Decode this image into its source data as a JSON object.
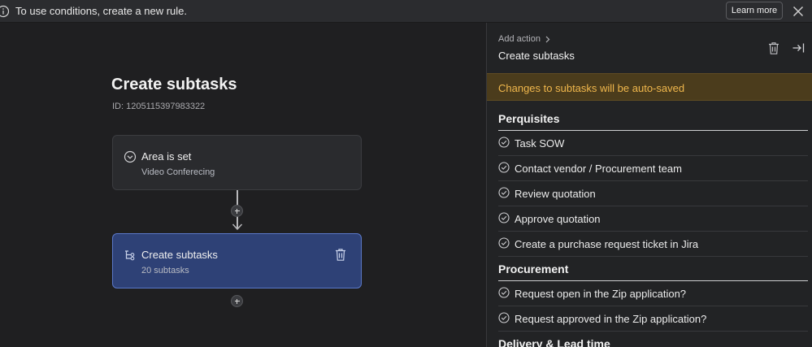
{
  "banner": {
    "message": "To use conditions, create a new rule.",
    "learn_more": "Learn more"
  },
  "rule": {
    "title": "Create subtasks",
    "id": "ID: 1205115397983322"
  },
  "condition_card": {
    "title": "Area is set",
    "subtitle": "Video Conferecing"
  },
  "action_card": {
    "title": "Create subtasks",
    "subtitle": "20 subtasks"
  },
  "panel": {
    "breadcrumb": "Add action",
    "title": "Create subtasks",
    "notice": "Changes to subtasks will be auto-saved",
    "sections": [
      {
        "title": "Perquisites",
        "items": [
          "Task SOW",
          "Contact vendor / Procurement team",
          "Review quotation",
          "Approve quotation",
          "Create a purchase request ticket in Jira"
        ]
      },
      {
        "title": "Procurement",
        "items": [
          "Request open in the Zip application?",
          "Request approved in the Zip application?"
        ]
      },
      {
        "title": "Delivery & Lead time",
        "items": []
      }
    ]
  },
  "colors": {
    "accent_card": "#2e4176",
    "notice_bg": "#4b3c1c",
    "notice_text": "#f0b74c"
  }
}
